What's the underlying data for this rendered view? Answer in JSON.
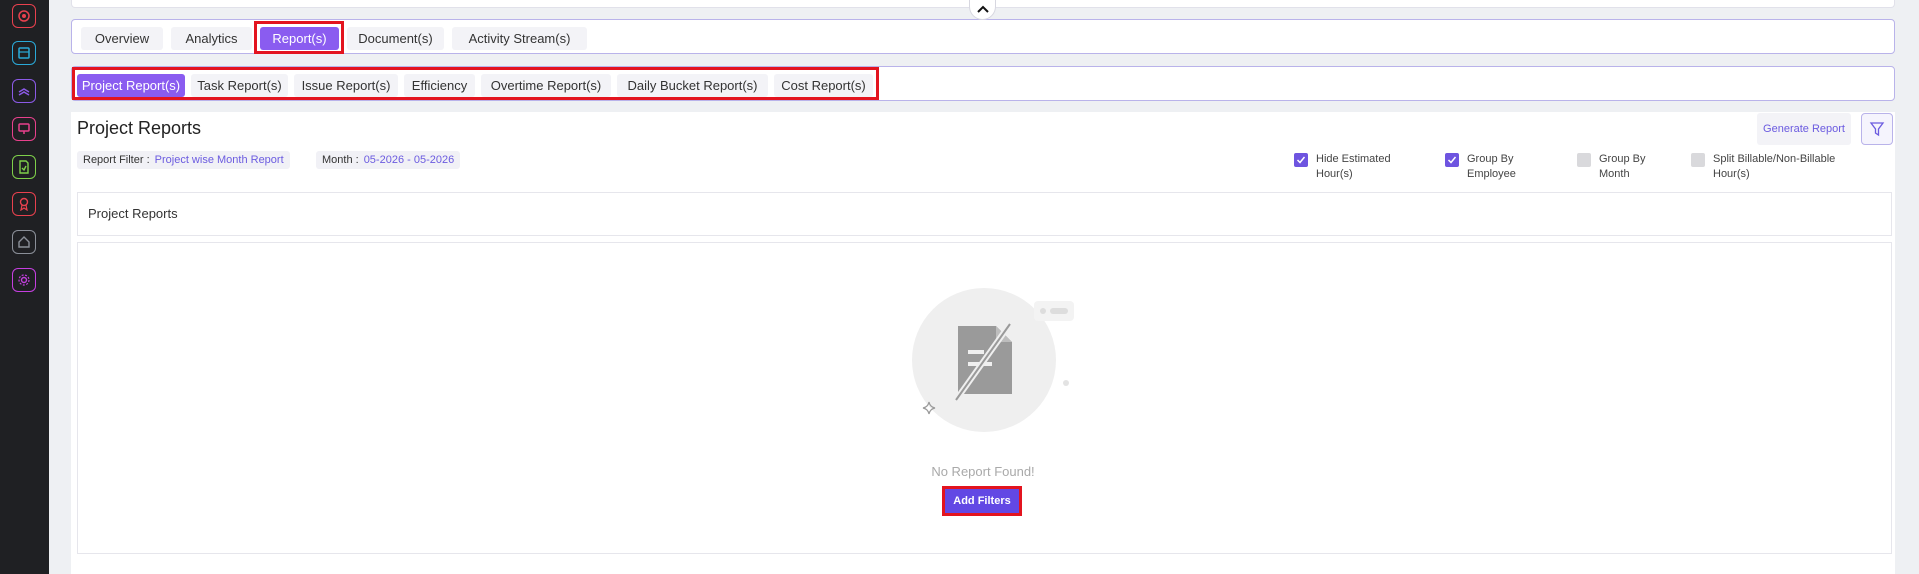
{
  "sidebar": {
    "icons": [
      {
        "name": "target-icon",
        "color": "#e8414e"
      },
      {
        "name": "document-icon",
        "color": "#2aa9d8"
      },
      {
        "name": "layers-icon",
        "color": "#8b5ae6"
      },
      {
        "name": "presentation-icon",
        "color": "#e8418c"
      },
      {
        "name": "file-check-icon",
        "color": "#7ed04a"
      },
      {
        "name": "award-icon",
        "color": "#e8414e"
      },
      {
        "name": "home-icon",
        "color": "#8a8f98"
      },
      {
        "name": "settings-icon",
        "color": "#c53fe0"
      }
    ]
  },
  "tabs": [
    {
      "label": "Overview"
    },
    {
      "label": "Analytics"
    },
    {
      "label": "Report(s)",
      "active": true
    },
    {
      "label": "Document(s)"
    },
    {
      "label": "Activity Stream(s)"
    }
  ],
  "subtabs": [
    {
      "label": "Project Report(s)",
      "active": true
    },
    {
      "label": "Task Report(s)"
    },
    {
      "label": "Issue Report(s)"
    },
    {
      "label": "Efficiency"
    },
    {
      "label": "Overtime Report(s)"
    },
    {
      "label": "Daily Bucket Report(s)"
    },
    {
      "label": "Cost Report(s)"
    }
  ],
  "page": {
    "title": "Project Reports",
    "filter_key": "Report Filter :",
    "filter_value": "Project wise Month Report",
    "month_key": "Month :",
    "month_value": "05-2026 - 05-2026",
    "generate_label": "Generate Report"
  },
  "options": [
    {
      "line1": "Hide Estimated",
      "line2": "Hour(s)",
      "checked": true
    },
    {
      "line1": "Group By",
      "line2": "Employee",
      "checked": true
    },
    {
      "line1": "Group By",
      "line2": "Month",
      "checked": false
    },
    {
      "line1": "Split Billable/Non-Billable",
      "line2": "Hour(s)",
      "checked": false
    }
  ],
  "panel": {
    "title": "Project Reports"
  },
  "empty": {
    "message": "No Report Found!",
    "button_label": "Add Filters"
  },
  "colors": {
    "accent": "#8a5cf0",
    "highlight": "#e3141f",
    "button": "#6248e4"
  }
}
